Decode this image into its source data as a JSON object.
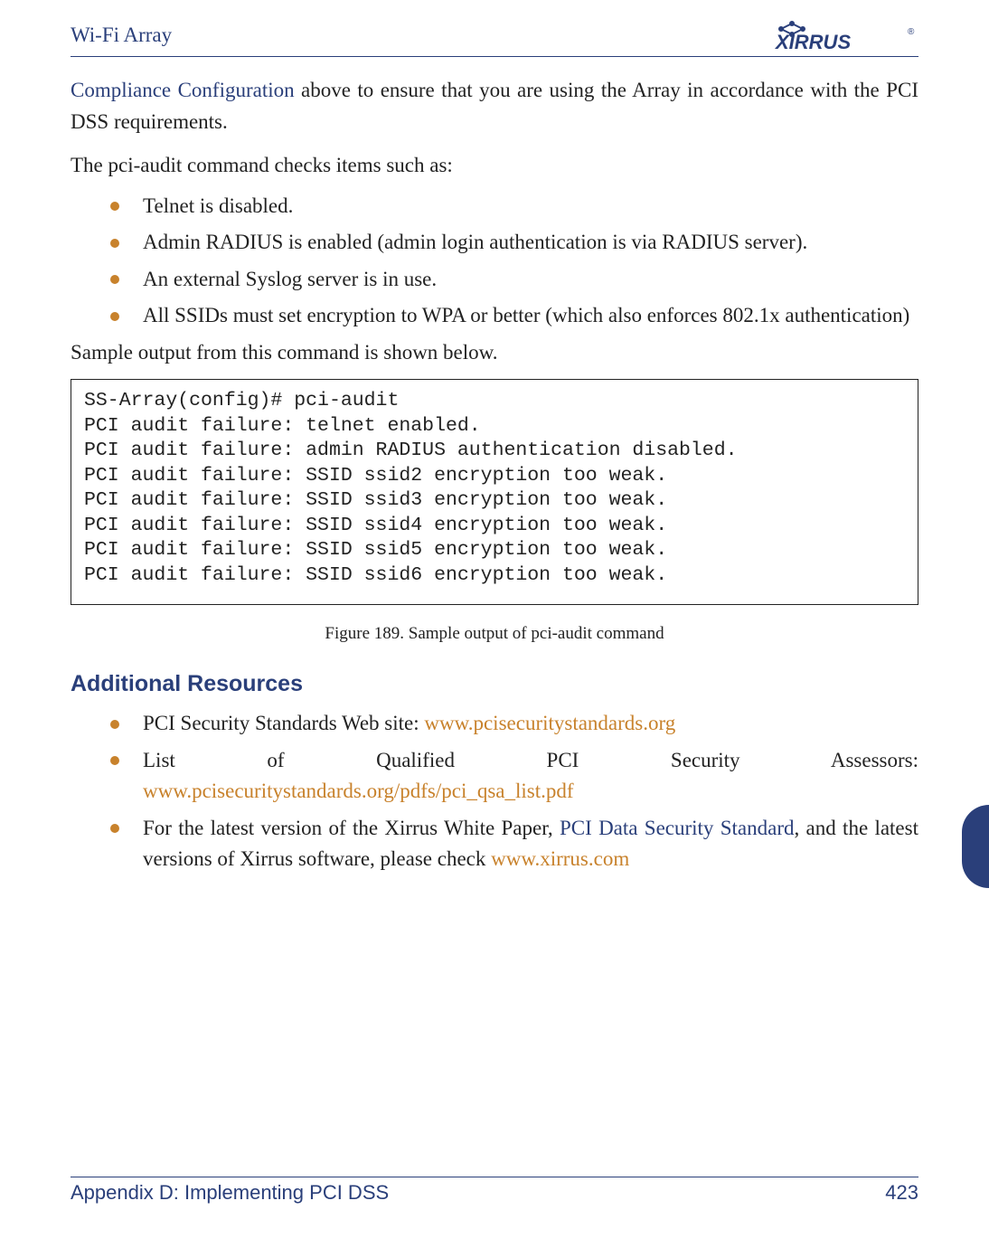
{
  "header": {
    "title": "Wi-Fi Array",
    "brand": "XIRRUS"
  },
  "intro": {
    "link_text": "Compliance Configuration",
    "rest": " above to ensure that you are using the Array in accordance with the PCI DSS requirements."
  },
  "para2": "The pci-audit command checks items such as:",
  "bullets1": [
    "Telnet is disabled.",
    "Admin RADIUS is enabled (admin login authentication is via RADIUS server).",
    "An external Syslog server is in use.",
    "All SSIDs must set encryption to WPA or better (which also enforces 802.1x authentication)"
  ],
  "para3": "Sample output from this command is shown below.",
  "code_lines": [
    "SS-Array(config)# pci-audit",
    "PCI audit failure: telnet enabled.",
    "PCI audit failure: admin RADIUS authentication disabled.",
    "PCI audit failure: SSID ssid2 encryption too weak.",
    "PCI audit failure: SSID ssid3 encryption too weak.",
    "PCI audit failure: SSID ssid4 encryption too weak.",
    "PCI audit failure: SSID ssid5 encryption too weak.",
    "PCI audit failure: SSID ssid6 encryption too weak."
  ],
  "figure_caption": "Figure 189. Sample output of pci-audit command",
  "section_heading": "Additional Resources",
  "resources": [
    {
      "prefix": "PCI Security Standards Web site: ",
      "link": "www.pcisecuritystandards.org",
      "suffix": ""
    },
    {
      "prefix": "List of Qualified PCI Security Assessors: ",
      "link": "www.pcisecuritystandards.org/pdfs/pci_qsa_list.pdf",
      "suffix": ""
    },
    {
      "prefix": "For the latest version of the Xirrus White Paper, ",
      "link": "PCI Data Security Standard",
      "mid": ", and the latest versions of Xirrus software, please check ",
      "link2": "www.xirrus.com",
      "suffix": ""
    }
  ],
  "footer": {
    "left": "Appendix D: Implementing PCI DSS",
    "right": "423"
  }
}
